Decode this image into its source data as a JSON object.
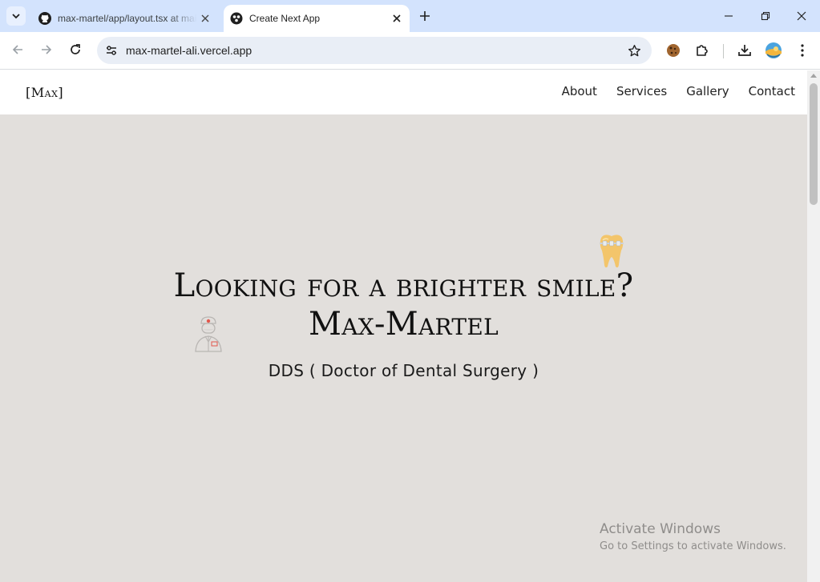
{
  "browser": {
    "tabs": [
      {
        "title": "max-martel/app/layout.tsx at main",
        "icon": "github-icon",
        "active": false
      },
      {
        "title": "Create Next App",
        "icon": "vercel-app-icon",
        "active": true
      }
    ],
    "address_bar": {
      "url": "max-martel-ali.vercel.app"
    }
  },
  "site": {
    "logo": "[Max]",
    "nav": [
      {
        "label": "About"
      },
      {
        "label": "Services"
      },
      {
        "label": "Gallery"
      },
      {
        "label": "Contact"
      }
    ],
    "hero": {
      "headline_line1": "Looking for a brighter smile?",
      "headline_line2": "Max-Martel",
      "subtitle": "DDS ( Doctor of Dental Surgery )",
      "decorations": [
        "tooth-braces-icon",
        "dentist-icon"
      ]
    }
  },
  "watermark": {
    "line1": "Activate Windows",
    "line2": "Go to Settings to activate Windows."
  },
  "colors": {
    "tabstrip": "#d3e3fd",
    "page_background": "#e2dfdc",
    "tooth": "#f3c56b"
  }
}
